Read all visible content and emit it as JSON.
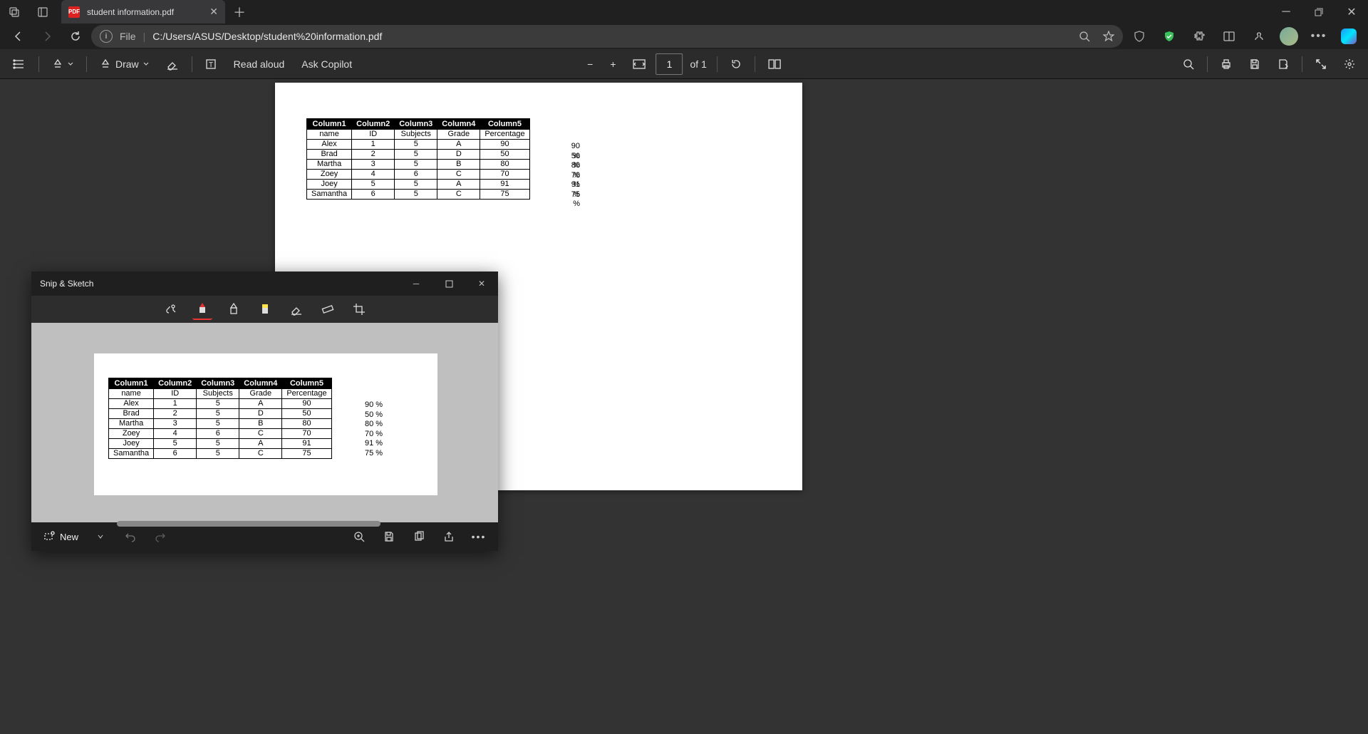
{
  "browser": {
    "tab_title": "student information.pdf",
    "url_file_label": "File",
    "url": "C:/Users/ASUS/Desktop/student%20information.pdf"
  },
  "pdf_toolbar": {
    "draw": "Draw",
    "read_aloud": "Read aloud",
    "ask_copilot": "Ask Copilot",
    "page_current": "1",
    "page_of": "of 1"
  },
  "table": {
    "headers": [
      "Column1",
      "Column2",
      "Column3",
      "Column4",
      "Column5"
    ],
    "sub": [
      "name",
      "ID",
      "Subjects",
      "Grade",
      "Percentage"
    ],
    "rows": [
      [
        "Alex",
        "1",
        "5",
        "A",
        "90"
      ],
      [
        "Brad",
        "2",
        "5",
        "D",
        "50"
      ],
      [
        "Martha",
        "3",
        "5",
        "B",
        "80"
      ],
      [
        "Zoey",
        "4",
        "6",
        "C",
        "70"
      ],
      [
        "Joey",
        "5",
        "5",
        "A",
        "91"
      ],
      [
        "Samantha",
        "6",
        "5",
        "C",
        "75"
      ]
    ],
    "pct": [
      "90 %",
      "50 %",
      "80 %",
      "70 %",
      "91 %",
      "75 %"
    ]
  },
  "snip": {
    "title": "Snip & Sketch",
    "new_btn": "New"
  }
}
